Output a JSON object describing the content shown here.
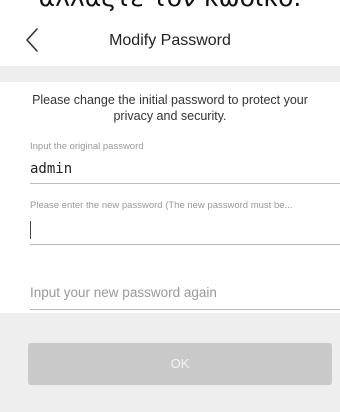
{
  "top_caption": "αλλάξτε τον κωδικό.",
  "nav": {
    "title": "Modify Password"
  },
  "info_text": "Please change the initial password to protect your privacy and security.",
  "original_password": {
    "label": "Input the original password",
    "value": "admin"
  },
  "new_password": {
    "label": "Please enter the new password (The new password must be...",
    "value": ""
  },
  "confirm_password": {
    "placeholder": "Input your new password again"
  },
  "ok_button": {
    "label": "OK"
  },
  "icons": {
    "back": "chevron-left-icon"
  },
  "colors": {
    "band": "#eeeeee",
    "button": "#c9c9c9",
    "button_text": "#f4f4f4"
  }
}
